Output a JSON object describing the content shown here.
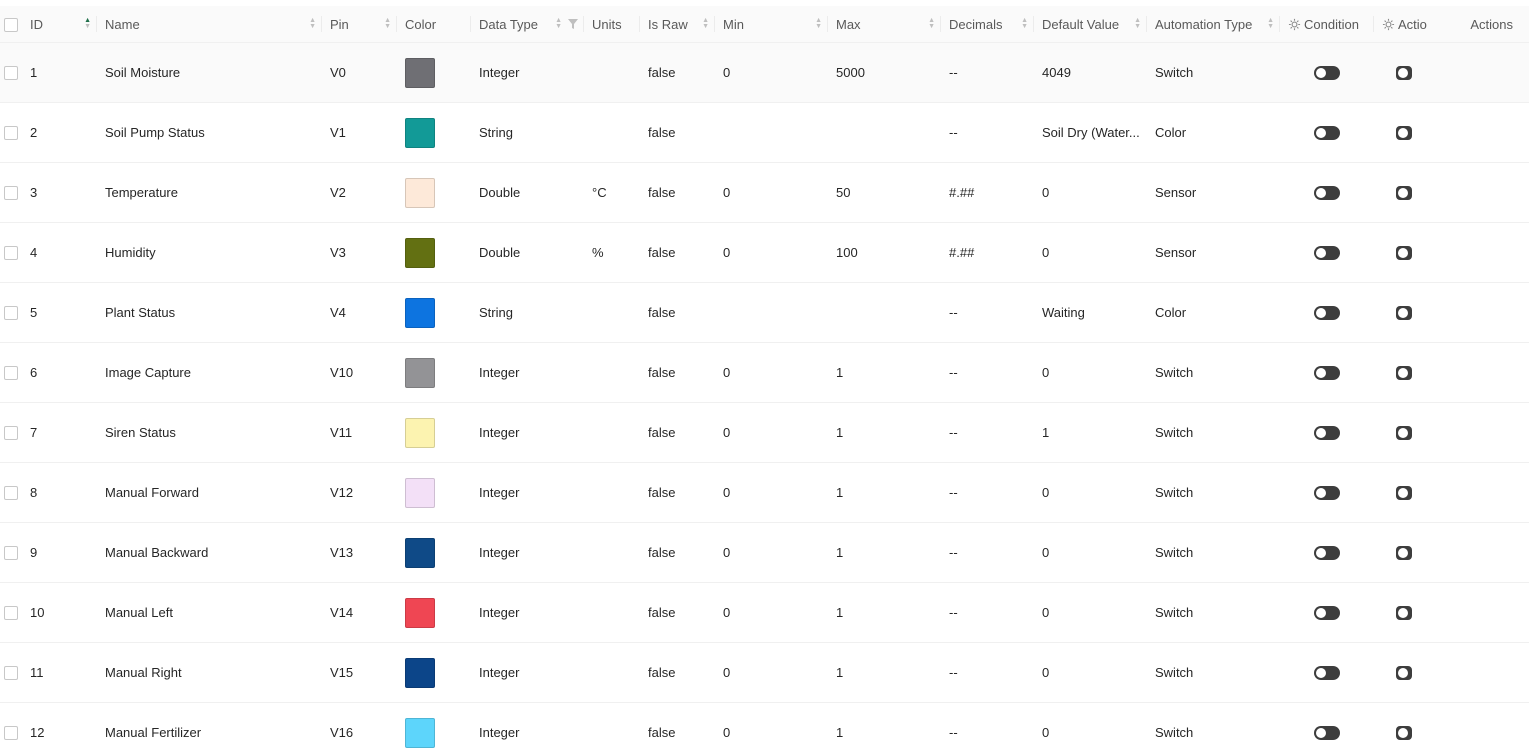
{
  "columns": {
    "id": "ID",
    "name": "Name",
    "pin": "Pin",
    "color": "Color",
    "data_type": "Data Type",
    "units": "Units",
    "is_raw": "Is Raw",
    "min": "Min",
    "max": "Max",
    "decimals": "Decimals",
    "default_value": "Default Value",
    "automation_type": "Automation Type",
    "condition": "Condition",
    "action": "Actio",
    "actions": "Actions"
  },
  "icons": {
    "sort": "sort-icon",
    "filter": "filter-icon",
    "gear": "gear-icon",
    "copy": "copy-icon",
    "delete": "delete-icon"
  },
  "colors": {
    "sort_active": "#1f6f4a",
    "copy": "#2dba62",
    "delete": "#e0283c"
  },
  "rows": [
    {
      "id": "1",
      "name": "Soil Moisture",
      "pin": "V0",
      "color": "#6f6f74",
      "data_type": "Integer",
      "units": "",
      "is_raw": "false",
      "min": "0",
      "max": "5000",
      "decimals": "--",
      "default_value": "4049",
      "automation_type": "Switch"
    },
    {
      "id": "2",
      "name": "Soil Pump Status",
      "pin": "V1",
      "color": "#129a97",
      "data_type": "String",
      "units": "",
      "is_raw": "false",
      "min": "",
      "max": "",
      "decimals": "--",
      "default_value": "Soil Dry (Water...",
      "automation_type": "Color"
    },
    {
      "id": "3",
      "name": "Temperature",
      "pin": "V2",
      "color": "#fde9d9",
      "data_type": "Double",
      "units": "°C",
      "is_raw": "false",
      "min": "0",
      "max": "50",
      "decimals": "#.##",
      "default_value": "0",
      "automation_type": "Sensor"
    },
    {
      "id": "4",
      "name": "Humidity",
      "pin": "V3",
      "color": "#637012",
      "data_type": "Double",
      "units": "%",
      "is_raw": "false",
      "min": "0",
      "max": "100",
      "decimals": "#.##",
      "default_value": "0",
      "automation_type": "Sensor"
    },
    {
      "id": "5",
      "name": "Plant Status",
      "pin": "V4",
      "color": "#0d74e0",
      "data_type": "String",
      "units": "",
      "is_raw": "false",
      "min": "",
      "max": "",
      "decimals": "--",
      "default_value": "Waiting",
      "automation_type": "Color"
    },
    {
      "id": "6",
      "name": "Image Capture",
      "pin": "V10",
      "color": "#939396",
      "data_type": "Integer",
      "units": "",
      "is_raw": "false",
      "min": "0",
      "max": "1",
      "decimals": "--",
      "default_value": "0",
      "automation_type": "Switch"
    },
    {
      "id": "7",
      "name": "Siren Status",
      "pin": "V11",
      "color": "#fcf3b0",
      "data_type": "Integer",
      "units": "",
      "is_raw": "false",
      "min": "0",
      "max": "1",
      "decimals": "--",
      "default_value": "1",
      "automation_type": "Switch"
    },
    {
      "id": "8",
      "name": "Manual Forward",
      "pin": "V12",
      "color": "#f3e0f7",
      "data_type": "Integer",
      "units": "",
      "is_raw": "false",
      "min": "0",
      "max": "1",
      "decimals": "--",
      "default_value": "0",
      "automation_type": "Switch"
    },
    {
      "id": "9",
      "name": "Manual Backward",
      "pin": "V13",
      "color": "#0f4a87",
      "data_type": "Integer",
      "units": "",
      "is_raw": "false",
      "min": "0",
      "max": "1",
      "decimals": "--",
      "default_value": "0",
      "automation_type": "Switch"
    },
    {
      "id": "10",
      "name": "Manual Left",
      "pin": "V14",
      "color": "#ef4653",
      "data_type": "Integer",
      "units": "",
      "is_raw": "false",
      "min": "0",
      "max": "1",
      "decimals": "--",
      "default_value": "0",
      "automation_type": "Switch"
    },
    {
      "id": "11",
      "name": "Manual Right",
      "pin": "V15",
      "color": "#0c4589",
      "data_type": "Integer",
      "units": "",
      "is_raw": "false",
      "min": "0",
      "max": "1",
      "decimals": "--",
      "default_value": "0",
      "automation_type": "Switch"
    },
    {
      "id": "12",
      "name": "Manual Fertilizer",
      "pin": "V16",
      "color": "#5dd5fb",
      "data_type": "Integer",
      "units": "",
      "is_raw": "false",
      "min": "0",
      "max": "1",
      "decimals": "--",
      "default_value": "0",
      "automation_type": "Switch"
    }
  ]
}
